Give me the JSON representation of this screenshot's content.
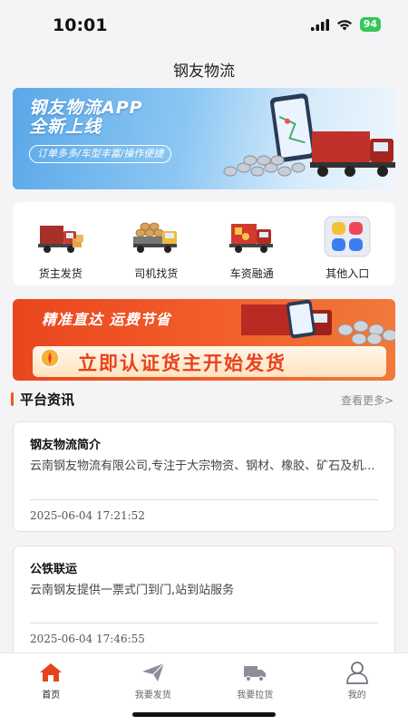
{
  "status": {
    "time": "10:01",
    "battery": "94"
  },
  "header": {
    "title": "钢友物流"
  },
  "banner_top": {
    "title_line1": "钢友物流APP",
    "title_line2": "全新上线",
    "tagline": "订单多多/车型丰富/操作便捷"
  },
  "quick_actions": [
    {
      "label": "货主发货",
      "icon": "shipper-truck-icon"
    },
    {
      "label": "司机找货",
      "icon": "driver-truck-icon"
    },
    {
      "label": "车资融通",
      "icon": "finance-truck-icon"
    },
    {
      "label": "其他入口",
      "icon": "grid-apps-icon"
    }
  ],
  "banner_promo": {
    "headline": "精准直达  运费节省",
    "cta": "立即认证货主开始发货"
  },
  "news": {
    "title": "平台资讯",
    "more": "查看更多>",
    "items": [
      {
        "title": "钢友物流简介",
        "body": "云南钢友物流有限公司,专注于大宗物资、钢材、橡胶、矿石及机...",
        "time": "2025-06-04 17:21:52"
      },
      {
        "title": "公铁联运",
        "body": "云南钢友提供一票式门到门,站到站服务",
        "time": "2025-06-04 17:46:55"
      }
    ]
  },
  "tabbar": [
    {
      "label": "首页",
      "active": true
    },
    {
      "label": "我要发货",
      "active": false
    },
    {
      "label": "我要拉货",
      "active": false
    },
    {
      "label": "我的",
      "active": false
    }
  ],
  "colors": {
    "accent": "#f05a22",
    "tab_active": "#e8421c"
  }
}
